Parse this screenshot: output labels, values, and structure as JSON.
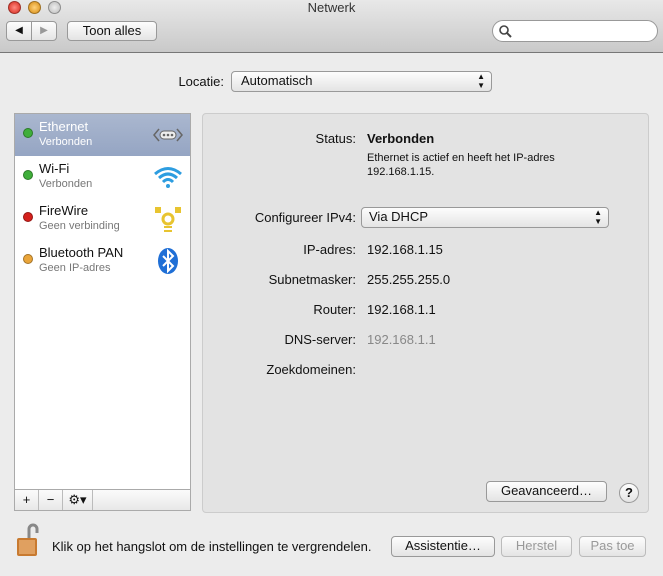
{
  "window": {
    "title": "Netwerk"
  },
  "toolbar": {
    "show_all": "Toon alles",
    "search_placeholder": ""
  },
  "location": {
    "label": "Locatie:",
    "value": "Automatisch"
  },
  "services": [
    {
      "name": "Ethernet",
      "status": "Verbonden",
      "color": "#3fae3a",
      "icon": "ethernet-icon"
    },
    {
      "name": "Wi-Fi",
      "status": "Verbonden",
      "color": "#3fae3a",
      "icon": "wifi-icon"
    },
    {
      "name": "FireWire",
      "status": "Geen verbinding",
      "color": "#d4201c",
      "icon": "firewire-icon"
    },
    {
      "name": "Bluetooth PAN",
      "status": "Geen IP-adres",
      "color": "#eaa53a",
      "icon": "bluetooth-icon"
    }
  ],
  "details": {
    "status_label": "Status:",
    "status_value": "Verbonden",
    "status_desc1": "Ethernet is actief en heeft het IP-adres",
    "status_desc2": "192.168.1.15.",
    "configure_label": "Configureer IPv4:",
    "configure_value": "Via DHCP",
    "ip_label": "IP-adres:",
    "ip_value": "192.168.1.15",
    "subnet_label": "Subnetmasker:",
    "subnet_value": "255.255.255.0",
    "router_label": "Router:",
    "router_value": "192.168.1.1",
    "dns_label": "DNS-server:",
    "dns_value": "192.168.1.1",
    "search_domains_label": "Zoekdomeinen:",
    "advanced": "Geavanceerd…",
    "help": "?"
  },
  "sidebar_bar": {
    "add": "+",
    "remove": "−"
  },
  "footer": {
    "lock_text": "Klik op het hangslot om de instellingen te vergrendelen.",
    "assist": "Assistentie…",
    "revert": "Herstel",
    "apply": "Pas toe"
  }
}
